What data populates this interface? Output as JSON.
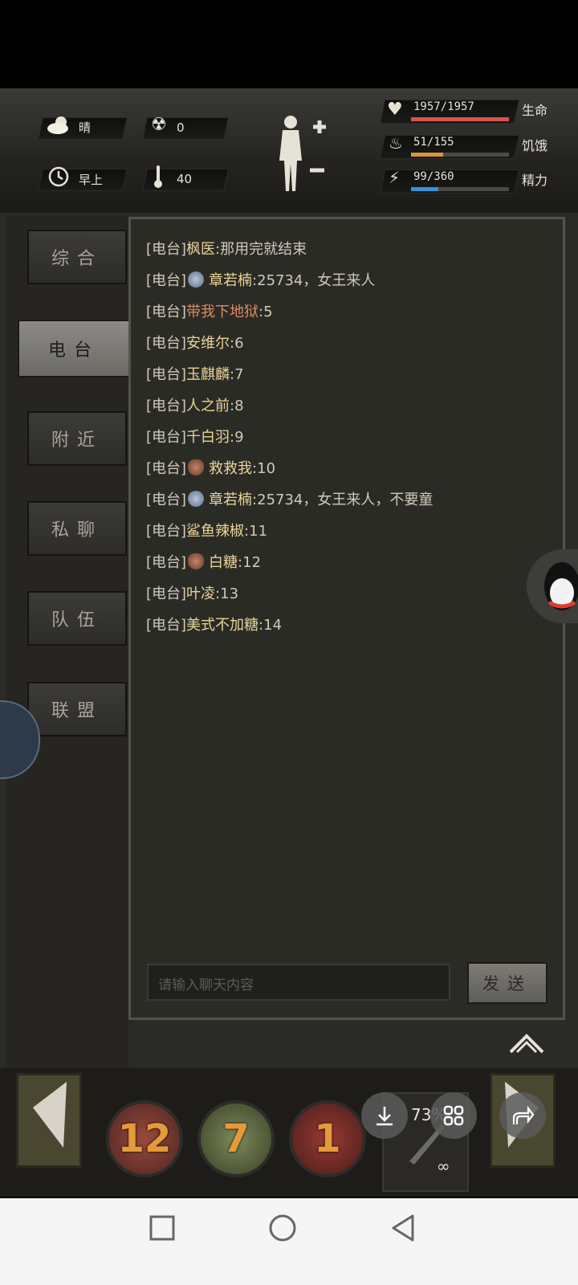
{
  "hud": {
    "weather": "晴",
    "radiation": "0",
    "time_of_day": "早上",
    "temperature": "40",
    "vitals": [
      {
        "label": "生命",
        "value": "1957/1957",
        "fraction": 1.0,
        "color": "#d9534f"
      },
      {
        "label": "饥饿",
        "value": "51/155",
        "fraction": 0.33,
        "color": "#d9963a"
      },
      {
        "label": "精力",
        "value": "99/360",
        "fraction": 0.275,
        "color": "#3a8fd9"
      }
    ]
  },
  "tabs": [
    "综合",
    "电台",
    "附近",
    "私聊",
    "队伍",
    "联盟"
  ],
  "active_tab": "电台",
  "messages": [
    {
      "tag": "[电台]",
      "nick": "枫医",
      "body": ":那用完就结束"
    },
    {
      "tag": "[电台]",
      "badge": "blue",
      "nick": "章若楠",
      "body": ":25734，女王来人"
    },
    {
      "tag": "[电台]",
      "nick": "带我下地狱",
      "nick_color": "red",
      "body": ":5"
    },
    {
      "tag": "[电台]",
      "nick": "安维尔",
      "body": ":6"
    },
    {
      "tag": "[电台]",
      "nick": "玉麒麟",
      "body": ":7"
    },
    {
      "tag": "[电台]",
      "nick": "人之前",
      "body": ":8"
    },
    {
      "tag": "[电台]",
      "nick": "千白羽",
      "body": ":9"
    },
    {
      "tag": "[电台]",
      "badge": "brown",
      "nick": "救救我",
      "body": ":10"
    },
    {
      "tag": "[电台]",
      "badge": "blue",
      "nick": "章若楠",
      "body": ":25734，女王来人，不要童"
    },
    {
      "tag": "[电台]",
      "nick": "鲨鱼辣椒",
      "body": ":11"
    },
    {
      "tag": "[电台]",
      "badge": "brown",
      "nick": "白糖",
      "body": ":12"
    },
    {
      "tag": "[电台]",
      "nick": "叶凌",
      "body": ":13"
    },
    {
      "tag": "[电台]",
      "nick": "美式不加糖",
      "body": ":14"
    }
  ],
  "chat_input": {
    "placeholder": "请输入聊天内容"
  },
  "send_label": "发送",
  "action_slots": [
    "12",
    "7",
    "1"
  ],
  "weapon_slot": {
    "count": "∞",
    "percent": "73%"
  },
  "icons": {
    "weather": "partly-cloudy-icon",
    "radiation": "radiation-icon",
    "clock": "clock-icon",
    "thermometer": "thermometer-icon",
    "heart": "heart-icon",
    "stomach": "stomach-icon",
    "energy": "energy-icon"
  }
}
